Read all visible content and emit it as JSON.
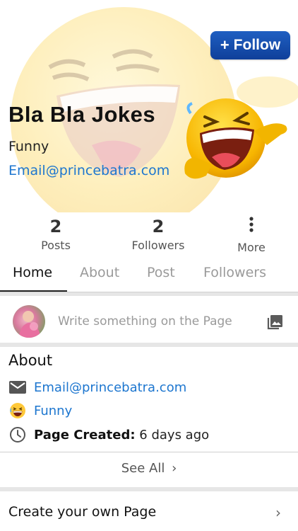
{
  "header": {
    "follow_label": "Follow",
    "follow_icon": "plus-icon",
    "page_name": "Bla Bla Jokes",
    "category": "Funny",
    "email": "Email@princebatra.com"
  },
  "stats": {
    "posts_count": "2",
    "posts_label": "Posts",
    "followers_count": "2",
    "followers_label": "Followers",
    "more_icon": "more-vertical-icon",
    "more_label": "More"
  },
  "tabs": [
    {
      "label": "Home",
      "active": true
    },
    {
      "label": "About",
      "active": false
    },
    {
      "label": "Post",
      "active": false
    },
    {
      "label": "Followers",
      "active": false
    }
  ],
  "composer": {
    "placeholder": "Write something on the Page",
    "photo_icon": "photo-icon"
  },
  "about": {
    "title": "About",
    "email": "Email@princebatra.com",
    "category": "Funny",
    "created_label": "Page Created:",
    "created_value": "6 days ago"
  },
  "see_all": "See All",
  "create_page": "Create your own Page",
  "colors": {
    "accent_blue": "#1d76cf",
    "follow_button": "#1a54b4",
    "divider": "#e6e6e6"
  }
}
